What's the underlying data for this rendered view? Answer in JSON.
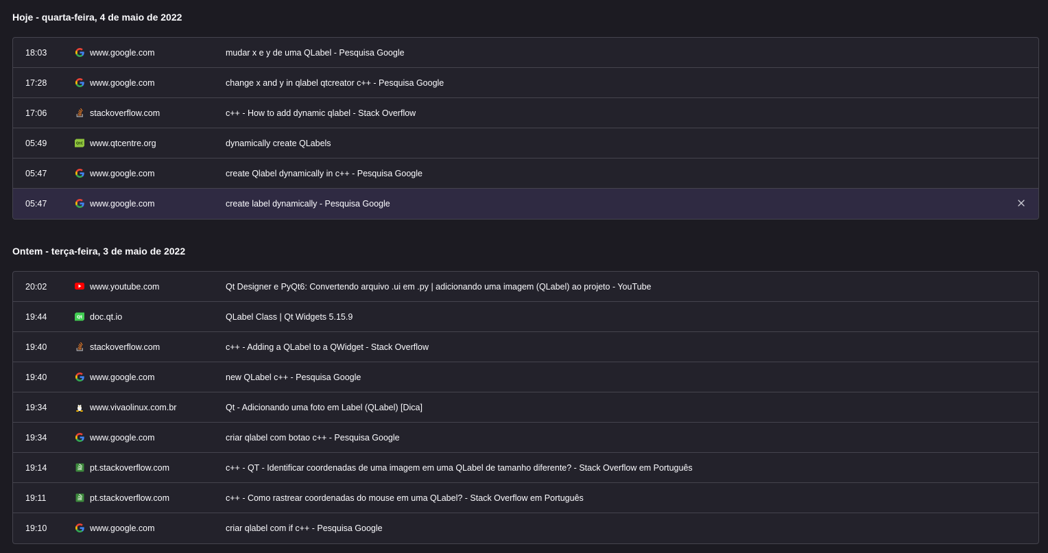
{
  "groups": [
    {
      "heading": "Hoje - quarta-feira, 4 de maio de 2022",
      "rows": [
        {
          "time": "18:03",
          "icon": "google-icon",
          "domain": "www.google.com",
          "title": "mudar x e y de uma QLabel - Pesquisa Google"
        },
        {
          "time": "17:28",
          "icon": "google-icon",
          "domain": "www.google.com",
          "title": "change x and y in qlabel qtcreator c++ - Pesquisa Google"
        },
        {
          "time": "17:06",
          "icon": "stackoverflow-icon",
          "domain": "stackoverflow.com",
          "title": "c++ - How to add dynamic qlabel - Stack Overflow"
        },
        {
          "time": "05:49",
          "icon": "qtcentre-icon",
          "domain": "www.qtcentre.org",
          "title": "dynamically create QLabels"
        },
        {
          "time": "05:47",
          "icon": "google-icon",
          "domain": "www.google.com",
          "title": "create Qlabel dynamically in c++ - Pesquisa Google"
        },
        {
          "time": "05:47",
          "icon": "google-icon",
          "domain": "www.google.com",
          "title": "create label dynamically - Pesquisa Google",
          "highlight": true
        }
      ]
    },
    {
      "heading": "Ontem - terça-feira, 3 de maio de 2022",
      "rows": [
        {
          "time": "20:02",
          "icon": "youtube-icon",
          "domain": "www.youtube.com",
          "title": "Qt Designer e PyQt6: Convertendo arquivo .ui em .py | adicionando uma imagem (QLabel) ao projeto - YouTube"
        },
        {
          "time": "19:44",
          "icon": "qt-icon",
          "domain": "doc.qt.io",
          "title": "QLabel Class | Qt Widgets 5.15.9"
        },
        {
          "time": "19:40",
          "icon": "stackoverflow-icon",
          "domain": "stackoverflow.com",
          "title": "c++ - Adding a QLabel to a QWidget - Stack Overflow"
        },
        {
          "time": "19:40",
          "icon": "google-icon",
          "domain": "www.google.com",
          "title": "new QLabel c++ - Pesquisa Google"
        },
        {
          "time": "19:34",
          "icon": "tux-icon",
          "domain": "www.vivaolinux.com.br",
          "title": "Qt - Adicionando uma foto em Label (QLabel) [Dica]"
        },
        {
          "time": "19:34",
          "icon": "google-icon",
          "domain": "www.google.com",
          "title": "criar qlabel com botao c++ - Pesquisa Google"
        },
        {
          "time": "19:14",
          "icon": "pt-stackoverflow-icon",
          "domain": "pt.stackoverflow.com",
          "title": "c++ - QT - Identificar coordenadas de uma imagem em uma QLabel de tamanho diferente? - Stack Overflow em Português"
        },
        {
          "time": "19:11",
          "icon": "pt-stackoverflow-icon",
          "domain": "pt.stackoverflow.com",
          "title": "c++ - Como rastrear coordenadas do mouse em uma QLabel? - Stack Overflow em Português"
        },
        {
          "time": "19:10",
          "icon": "google-icon",
          "domain": "www.google.com",
          "title": "criar qlabel com if c++ - Pesquisa Google"
        }
      ]
    }
  ],
  "colors": {
    "background": "#1c1b22",
    "card": "#23222b",
    "border": "#45444e",
    "highlight_row": "#2f2a42",
    "text": "#fbfbfe"
  }
}
